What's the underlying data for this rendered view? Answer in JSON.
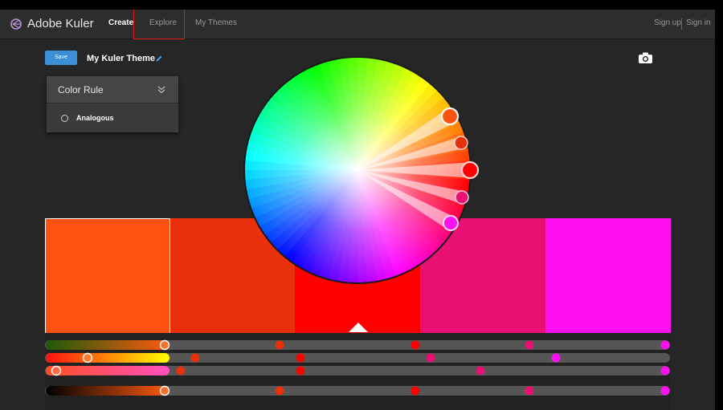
{
  "app": {
    "name": "Adobe Kuler"
  },
  "nav": {
    "create": "Create",
    "explore": "Explore",
    "my_themes": "My Themes",
    "sign_up": "Sign up",
    "sign_in": "Sign in"
  },
  "toolbar": {
    "save_label": "Save",
    "theme_name": "My Kuler Theme"
  },
  "color_rule": {
    "title": "Color Rule",
    "selected": "Analogous"
  },
  "theme": {
    "swatches": [
      "#ff5210",
      "#e8300c",
      "#ff0000",
      "#e81072",
      "#ff10f0"
    ],
    "selected_index": 0,
    "base_index": 2
  },
  "icons": {
    "logo": "kuler-logo-icon",
    "edit": "pencil-icon",
    "camera": "camera-icon",
    "chevron": "double-chevron-down-icon"
  }
}
